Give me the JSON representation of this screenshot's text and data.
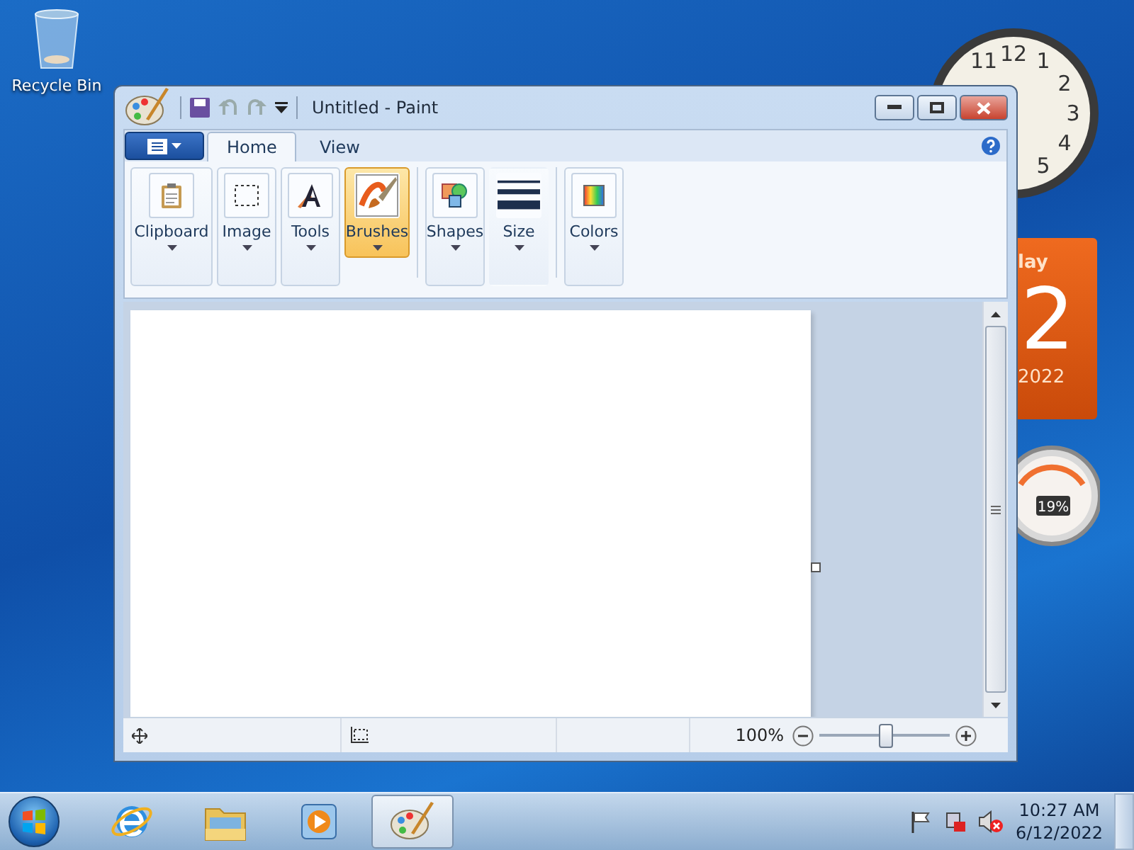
{
  "desktop_icons": [
    {
      "label": "Recycle Bin"
    }
  ],
  "gadgets": {
    "clock": {
      "numerals": [
        "11",
        "12",
        "1",
        "2",
        "3",
        "4",
        "5"
      ]
    },
    "calendar": {
      "weekday": "lay",
      "day": "2",
      "year": "2022"
    },
    "meter": {
      "reading": "19%"
    }
  },
  "window": {
    "title": "Untitled - Paint",
    "tabs": [
      {
        "label": "Home",
        "selected": true
      },
      {
        "label": "View",
        "selected": false
      }
    ],
    "groups": [
      {
        "label": "Clipboard",
        "kind": "clipboard",
        "selected": false
      },
      {
        "label": "Image",
        "kind": "select",
        "selected": false
      },
      {
        "label": "Tools",
        "kind": "tools",
        "selected": false
      },
      {
        "label": "Brushes",
        "kind": "brush",
        "selected": true
      },
      {
        "label": "Shapes",
        "kind": "shapes",
        "selected": false
      },
      {
        "label": "Size",
        "kind": "size",
        "selected": false
      },
      {
        "label": "Colors",
        "kind": "colors",
        "selected": false
      }
    ],
    "status_bar": {
      "zoom": "100%",
      "zoom_slider": {
        "level": 0.5
      }
    }
  },
  "taskbar": {
    "apps": [
      {
        "kind": "browser",
        "selected": false
      },
      {
        "kind": "folder",
        "selected": false
      },
      {
        "kind": "media",
        "selected": false
      },
      {
        "kind": "paint",
        "selected": true
      }
    ],
    "time": "10:27 AM",
    "date": "6/12/2022"
  }
}
